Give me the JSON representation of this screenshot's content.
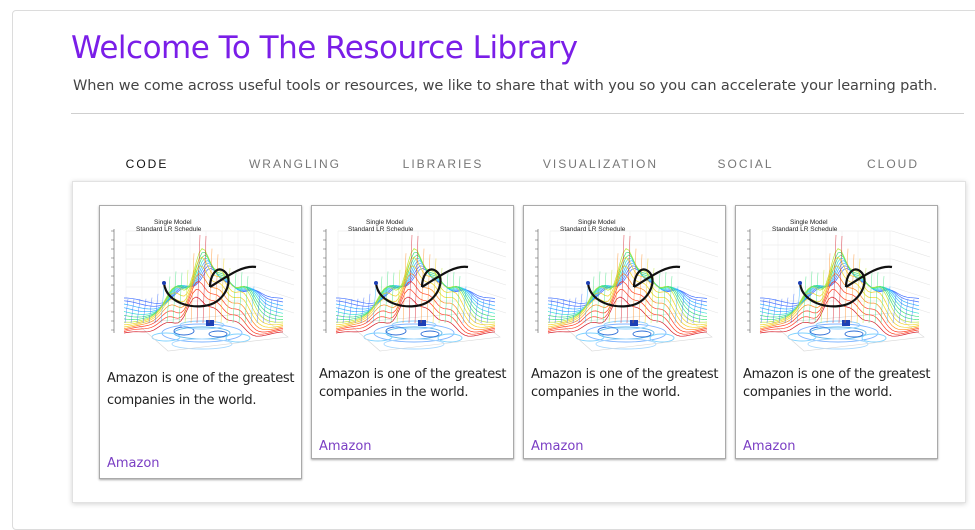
{
  "header": {
    "title": "Welcome To The Resource Library",
    "subtitle": "When we come across useful tools or resources, we like to share that with you so you can accelerate your learning path."
  },
  "tabs": [
    {
      "label": "CODE",
      "active": true
    },
    {
      "label": "WRANGLING",
      "active": false
    },
    {
      "label": "LIBRARIES",
      "active": false
    },
    {
      "label": "VISUALIZATION",
      "active": false
    },
    {
      "label": "SOCIAL",
      "active": false
    },
    {
      "label": "CLOUD",
      "active": false
    }
  ],
  "cards": [
    {
      "image_title_1": "Single Model",
      "image_title_2": "Standard LR Schedule",
      "description": "Amazon is one of the greatest companies in the world.",
      "link": "Amazon"
    },
    {
      "image_title_1": "Single Model",
      "image_title_2": "Standard LR Schedule",
      "description": "Amazon is one of the greatest companies in the world.",
      "link": "Amazon"
    },
    {
      "image_title_1": "Single Model",
      "image_title_2": "Standard LR Schedule",
      "description": "Amazon is one of the greatest companies in the world.",
      "link": "Amazon"
    },
    {
      "image_title_1": "Single Model",
      "image_title_2": "Standard LR Schedule",
      "description": "Amazon is one of the greatest companies in the world.",
      "link": "Amazon"
    }
  ],
  "colors": {
    "accent": "#7a1ee8",
    "link": "#7b3fc4"
  },
  "icons": {
    "card_image": "loss-surface-plot"
  }
}
